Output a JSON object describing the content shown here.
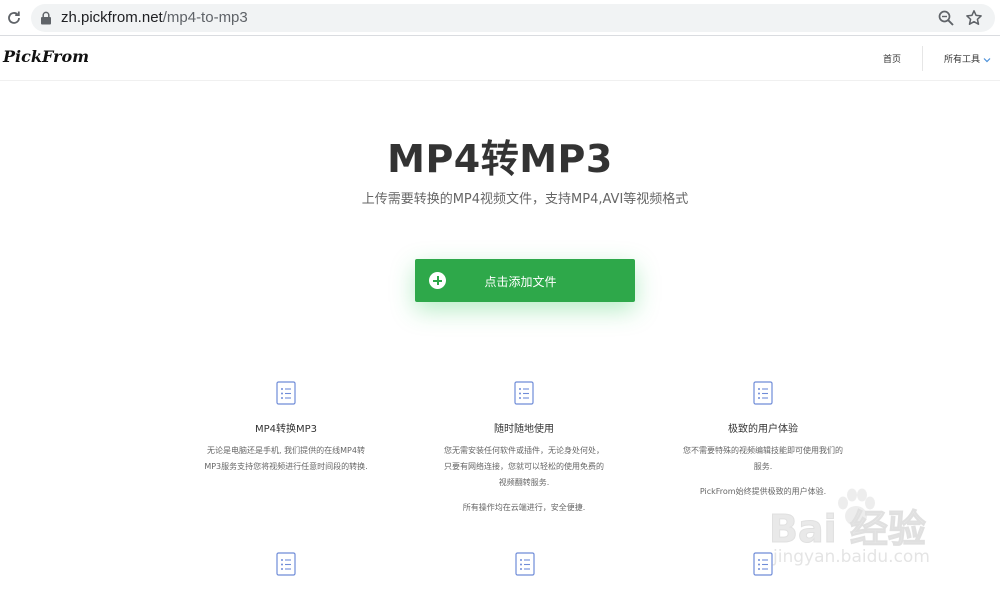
{
  "browser": {
    "url_host": "zh.pickfrom.net",
    "url_path": "/mp4-to-mp3"
  },
  "header": {
    "logo": "PickFrom",
    "nav_home": "首页",
    "nav_tools": "所有工具"
  },
  "hero": {
    "title": "MP4转MP3",
    "subtitle": "上传需要转换的MP4视频文件，支持MP4,AVI等视频格式",
    "upload_label": "点击添加文件"
  },
  "features": [
    {
      "title": "MP4转换MP3",
      "desc_lines": [
        "无论是电脑还是手机, 我们提供的在线MP4转",
        "MP3服务支持您将视频进行任意时间段的转换."
      ],
      "extra": ""
    },
    {
      "title": "随时随地使用",
      "desc_lines": [
        "您无需安装任何软件或插件，无论身处何处，",
        "只要有网络连接，您就可以轻松的使用免费的",
        "视频翻转服务."
      ],
      "extra": "所有操作均在云端进行，安全便捷."
    },
    {
      "title": "极致的用户体验",
      "desc_lines": [
        "您不需要特殊的视频编辑技能即可使用我们的",
        "服务."
      ],
      "extra": "PickFrom始终提供极致的用户体验."
    }
  ],
  "watermark": {
    "main": "Bai  经验",
    "sub": "jingyan.baidu.com"
  },
  "colors": {
    "accent_green": "#2ea84a",
    "icon_blue": "#6f8cd8"
  }
}
